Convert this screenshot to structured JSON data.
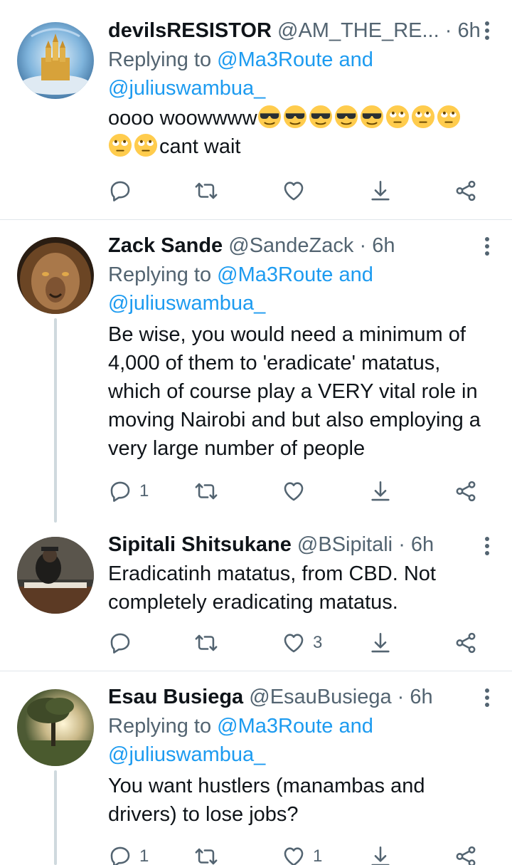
{
  "tweets": [
    {
      "name": "devilsRESISTOR",
      "handle": "@AM_THE_RE...",
      "separator": "·",
      "time": "6h",
      "replying_prefix": "Replying to",
      "mention1": "@Ma3Route and",
      "mention2": "@juliuswambua_",
      "text_start": "oooo woowwww",
      "text_end": "cant wait",
      "avatar": "castle-avatar",
      "reply_count": "",
      "retweet_count": "",
      "like_count": ""
    },
    {
      "name": "Zack Sande",
      "handle": "@SandeZack",
      "separator": "·",
      "time": "6h",
      "replying_prefix": "Replying to",
      "mention1": "@Ma3Route and",
      "mention2": "@juliuswambua_",
      "lines": [
        "Be wise, you would need a minimum of",
        "4,000 of them to 'eradicate' matatus,",
        "which of course play a VERY vital role in",
        "moving Nairobi and but also employing a",
        "very large number of people"
      ],
      "avatar": "lion-avatar",
      "reply_count": "1",
      "retweet_count": "",
      "like_count": ""
    },
    {
      "name": "Sipitali Shitsukane",
      "handle": "@BSipitali",
      "separator": "·",
      "time": "6h",
      "lines": [
        "Eradicatinh matatus, from CBD. Not",
        "completely eradicating matatus."
      ],
      "avatar": "piano-avatar",
      "reply_count": "",
      "retweet_count": "",
      "like_count": "3"
    },
    {
      "name": "Esau Busiega",
      "handle": "@EsauBusiega",
      "separator": "·",
      "time": "6h",
      "replying_prefix": "Replying to",
      "mention1": "@Ma3Route and",
      "mention2": "@juliuswambua_",
      "lines": [
        "You want hustlers (manambas and",
        "drivers) to lose jobs?"
      ],
      "avatar": "tree-avatar",
      "reply_count": "1",
      "retweet_count": "",
      "like_count": "1"
    }
  ],
  "icons": {
    "reply": "reply-icon",
    "retweet": "retweet-icon",
    "like": "heart-icon",
    "download": "download-icon",
    "share": "share-icon",
    "more": "more-options-icon",
    "emoji_cool": "sunglasses-emoji",
    "emoji_eyeroll": "eye-roll-emoji"
  },
  "colors": {
    "link": "#1d9bf0",
    "secondary_text": "#536471",
    "primary_text": "#0f1419",
    "thread_line": "#cfd9de",
    "divider": "#e1e6ea"
  }
}
